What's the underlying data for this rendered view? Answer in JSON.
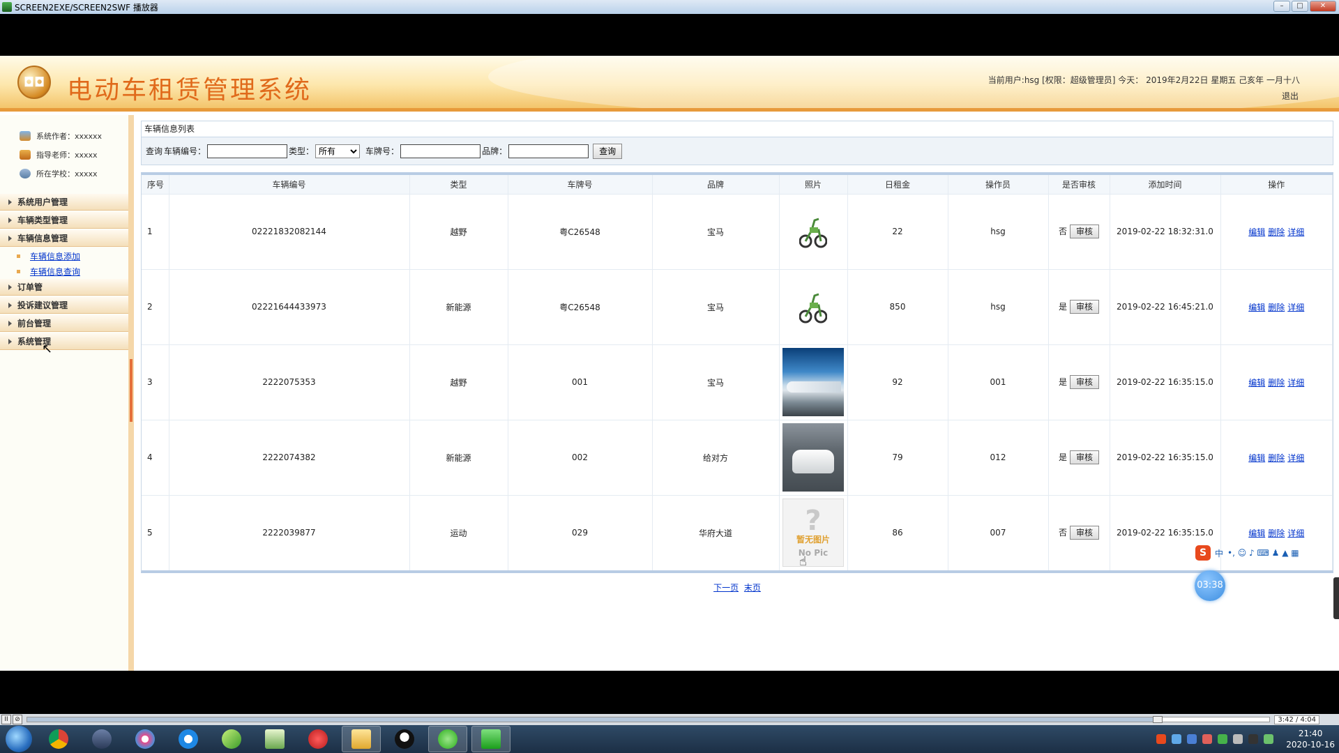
{
  "window": {
    "title": "SCREEN2EXE/SCREEN2SWF 播放器",
    "controls": {
      "minimize": "–",
      "maximize": "□",
      "close": "✕"
    }
  },
  "header": {
    "logo_text": "◘◘",
    "title": "电动车租赁管理系统",
    "user_info": "当前用户:hsg [权限：超级管理员] 今天： 2019年2月22日 星期五 己亥年 一月十八",
    "logout": "退出"
  },
  "sidebar": {
    "info": [
      {
        "icon": "user-icon",
        "text": "系统作者：xxxxxx"
      },
      {
        "icon": "teacher-icon",
        "text": "指导老师：xxxxx"
      },
      {
        "icon": "school-icon",
        "text": "所在学校：xxxxx"
      }
    ],
    "menu": [
      {
        "label": "系统用户管理"
      },
      {
        "label": "车辆类型管理"
      },
      {
        "label": "车辆信息管理",
        "sub": [
          "车辆信息添加",
          "车辆信息查询"
        ]
      },
      {
        "label": "订单管"
      },
      {
        "label": "投诉建议管理"
      },
      {
        "label": "前台管理"
      },
      {
        "label": "系统管理"
      }
    ]
  },
  "panel": {
    "title": "车辆信息列表",
    "search": {
      "prefix": "查询",
      "code_label": "车辆编号：",
      "code_value": "",
      "type_label": "类型：",
      "type_selected": "所有",
      "plate_label": "车牌号：",
      "plate_value": "",
      "brand_label": "品牌：",
      "brand_value": "",
      "submit": "查询"
    },
    "table": {
      "columns": [
        "序号",
        "车辆编号",
        "类型",
        "车牌号",
        "品牌",
        "照片",
        "日租金",
        "操作员",
        "是否审核",
        "添加时间",
        "操作"
      ],
      "audit_button": "审核",
      "actions": {
        "edit": "编辑",
        "delete": "删除",
        "detail": "详细"
      },
      "no_pic_text_cn": "暂无图片",
      "no_pic_text_en": "No Pic",
      "rows": [
        {
          "no": "1",
          "code": "02221832082144",
          "type": "越野",
          "plate": "粤C26548",
          "brand": "宝马",
          "photo": "bike",
          "rent": "22",
          "operator": "hsg",
          "audited": "否",
          "time": "2019-02-22 18:32:31.0"
        },
        {
          "no": "2",
          "code": "02221644433973",
          "type": "新能源",
          "plate": "粤C26548",
          "brand": "宝马",
          "photo": "bike",
          "rent": "850",
          "operator": "hsg",
          "audited": "是",
          "time": "2019-02-22 16:45:21.0"
        },
        {
          "no": "3",
          "code": "2222075353",
          "type": "越野",
          "plate": "001",
          "brand": "宝马",
          "photo": "train",
          "rent": "92",
          "operator": "001",
          "audited": "是",
          "time": "2019-02-22 16:35:15.0"
        },
        {
          "no": "4",
          "code": "2222074382",
          "type": "新能源",
          "plate": "002",
          "brand": "给对方",
          "photo": "car",
          "rent": "79",
          "operator": "012",
          "audited": "是",
          "time": "2019-02-22 16:35:15.0"
        },
        {
          "no": "5",
          "code": "2222039877",
          "type": "运动",
          "plate": "029",
          "brand": "华府大道",
          "photo": "none",
          "rent": "86",
          "operator": "007",
          "audited": "否",
          "time": "2019-02-22 16:35:15.0"
        }
      ]
    },
    "pager": {
      "next": "下一页",
      "last": "末页"
    }
  },
  "overlay": {
    "ime_logo": "S",
    "ime_label": "中",
    "ime_symbols": "•, ☺ ♪ ⌨ ♟ ▲ ▦",
    "timer": "03:38"
  },
  "player": {
    "pause": "II",
    "rewind": "⊘",
    "time": "3:42 / 4:04",
    "progress": 0.91
  },
  "taskbar": {
    "clock_time": "21:40",
    "clock_date": "2020-10-16",
    "apps": [
      "chrome-icon",
      "terminal-icon",
      "palette-icon",
      "browser-icon",
      "leaf-icon",
      "chart-icon",
      "flash-icon",
      "folder-icon",
      "qq-icon",
      "wechat-icon",
      "player-icon"
    ]
  },
  "colors": {
    "title_orange": "#e06a1b",
    "link_blue": "#0033cc",
    "header_border": "#e79a3b"
  }
}
